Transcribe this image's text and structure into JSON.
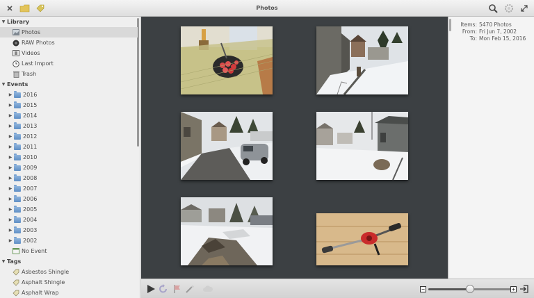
{
  "window": {
    "title": "Photos"
  },
  "sidebar": {
    "library": {
      "header": "Library",
      "items": [
        {
          "label": "Photos",
          "icon": "photos-icon",
          "selected": true
        },
        {
          "label": "RAW Photos",
          "icon": "camera-lens-icon"
        },
        {
          "label": "Videos",
          "icon": "film-icon"
        },
        {
          "label": "Last Import",
          "icon": "clock-icon"
        },
        {
          "label": "Trash",
          "icon": "trash-icon"
        }
      ]
    },
    "events": {
      "header": "Events",
      "items": [
        "2016",
        "2015",
        "2014",
        "2013",
        "2012",
        "2011",
        "2010",
        "2009",
        "2008",
        "2007",
        "2006",
        "2005",
        "2004",
        "2003",
        "2002"
      ],
      "no_event": "No Event"
    },
    "tags": {
      "header": "Tags",
      "items": [
        "Asbestos Shingle",
        "Asphalt Shingle",
        "Asphalt Wrap"
      ]
    }
  },
  "info": {
    "items_key": "Items:",
    "items_value": "5470 Photos",
    "from_key": "From:",
    "from_value": "Fri Jun 7, 2002",
    "to_key": "To:",
    "to_value": "Mon Feb 15, 2016"
  },
  "viewer": {
    "photos": [
      {
        "subject": "tomatoes-on-table"
      },
      {
        "subject": "snowy-yard-house"
      },
      {
        "subject": "driveway-car-snow"
      },
      {
        "subject": "snowy-backyard-shed"
      },
      {
        "subject": "snowy-lot-debris"
      },
      {
        "subject": "hand-drill-on-wood"
      }
    ]
  },
  "toolbar": {
    "zoom_level": 0.5,
    "zoom_out_label": "−",
    "zoom_in_label": "+"
  },
  "colors": {
    "viewer_bg": "#3c4043",
    "sidebar_bg": "#efefef",
    "selection": "#d9d9d9"
  }
}
